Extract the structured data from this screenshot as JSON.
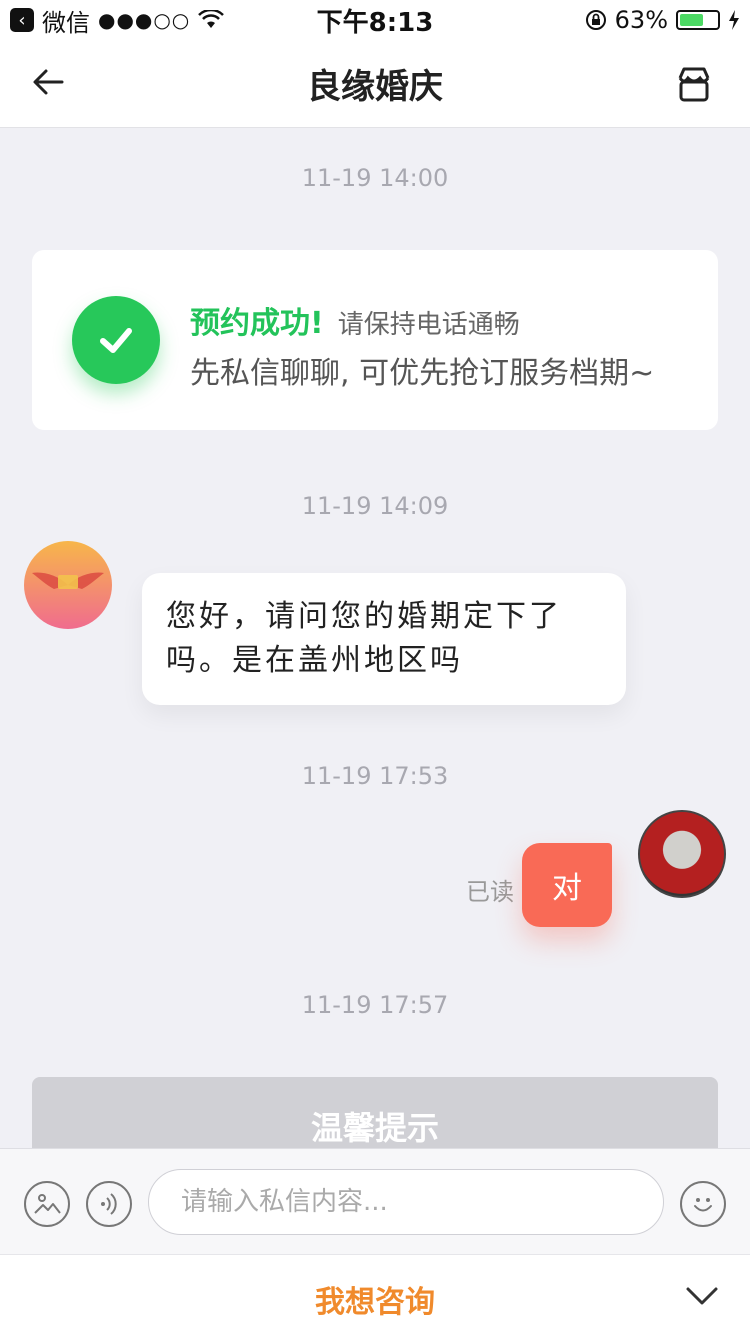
{
  "status_bar": {
    "carrier": "微信",
    "signal": "●●●○○",
    "time": "下午8:13",
    "battery_percent": "63%",
    "battery_level": 0.63
  },
  "nav": {
    "title": "良缘婚庆"
  },
  "messages": {
    "ts1": "11-19 14:00",
    "ts2": "11-19 14:09",
    "ts3": "11-19 17:53",
    "ts4": "11-19 17:57",
    "booking_card": {
      "success": "预约成功!",
      "hint": "请保持电话通畅",
      "desc": "先私信聊聊, 可优先抢订服务档期~"
    },
    "incoming_text": "您好，请问您的婚期定下了吗。是在盖州地区吗",
    "read_status": "已读",
    "outgoing_text": "对"
  },
  "tip_banner": {
    "label": "温馨提示"
  },
  "input_bar": {
    "placeholder": "请输入私信内容..."
  },
  "consult": {
    "label": "我想咨询"
  },
  "colors": {
    "success": "#23c35a",
    "outgoing_bubble": "#f96a56",
    "consult": "#f08a2c"
  }
}
